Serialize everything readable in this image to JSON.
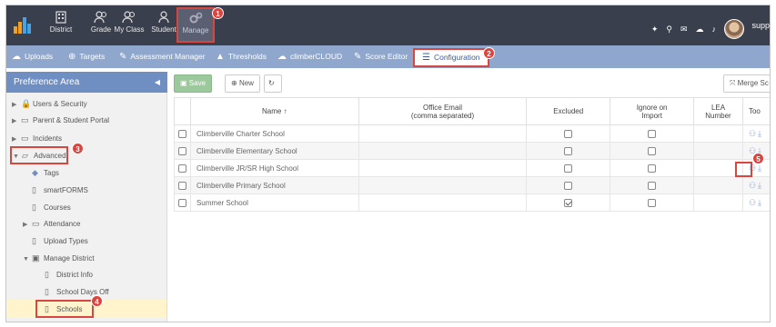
{
  "topnav": {
    "items": [
      {
        "label": "District"
      },
      {
        "label": "Grade"
      },
      {
        "label": "My Class"
      },
      {
        "label": "Student"
      },
      {
        "label": "Manage"
      }
    ],
    "user": "suppor"
  },
  "subnav": {
    "items": [
      {
        "label": "Uploads",
        "icon": "cloud-upload-icon"
      },
      {
        "label": "Targets",
        "icon": "target-icon"
      },
      {
        "label": "Assessment Manager",
        "icon": "pencil-icon"
      },
      {
        "label": "Thresholds",
        "icon": "warning-icon"
      },
      {
        "label": "climberCLOUD",
        "icon": "cloud-icon"
      },
      {
        "label": "Score Editor",
        "icon": "pencil-icon"
      },
      {
        "label": "Configuration",
        "icon": "list-icon"
      }
    ]
  },
  "sidebar": {
    "title": "Preference Area",
    "items": [
      {
        "label": "Users & Security"
      },
      {
        "label": "Parent & Student Portal"
      },
      {
        "label": "Incidents"
      },
      {
        "label": "Advanced"
      },
      {
        "label": "Tags"
      },
      {
        "label": "smartFORMS"
      },
      {
        "label": "Courses"
      },
      {
        "label": "Attendance"
      },
      {
        "label": "Upload Types"
      },
      {
        "label": "Manage District"
      },
      {
        "label": "District Info"
      },
      {
        "label": "School Days Off"
      },
      {
        "label": "Schools"
      }
    ]
  },
  "toolbar": {
    "save": "Save",
    "new": "New",
    "merge": "Merge Sc"
  },
  "table": {
    "headers": {
      "name": "Name ↑",
      "email": "Office Email\n(comma separated)",
      "excluded": "Excluded",
      "ignore": "Ignore on\nImport",
      "lea": "LEA\nNumber",
      "tools": "Too"
    },
    "rows": [
      {
        "name": "Climberville Charter School",
        "excluded": false,
        "ignore": false
      },
      {
        "name": "Climberville Elementary School",
        "excluded": false,
        "ignore": false
      },
      {
        "name": "Climberville JR/SR High School",
        "excluded": false,
        "ignore": false
      },
      {
        "name": "Climberville Primary School",
        "excluded": false,
        "ignore": false
      },
      {
        "name": "Summer School",
        "excluded": true,
        "ignore": false
      }
    ]
  },
  "callouts": [
    "1",
    "2",
    "3",
    "4",
    "5"
  ],
  "colors": {
    "navbar": "#3a3f4d",
    "subbar": "#8fa7cd",
    "panel_header": "#6f8fc2",
    "callout": "#d9463f",
    "selected_row": "#fff4cc"
  }
}
